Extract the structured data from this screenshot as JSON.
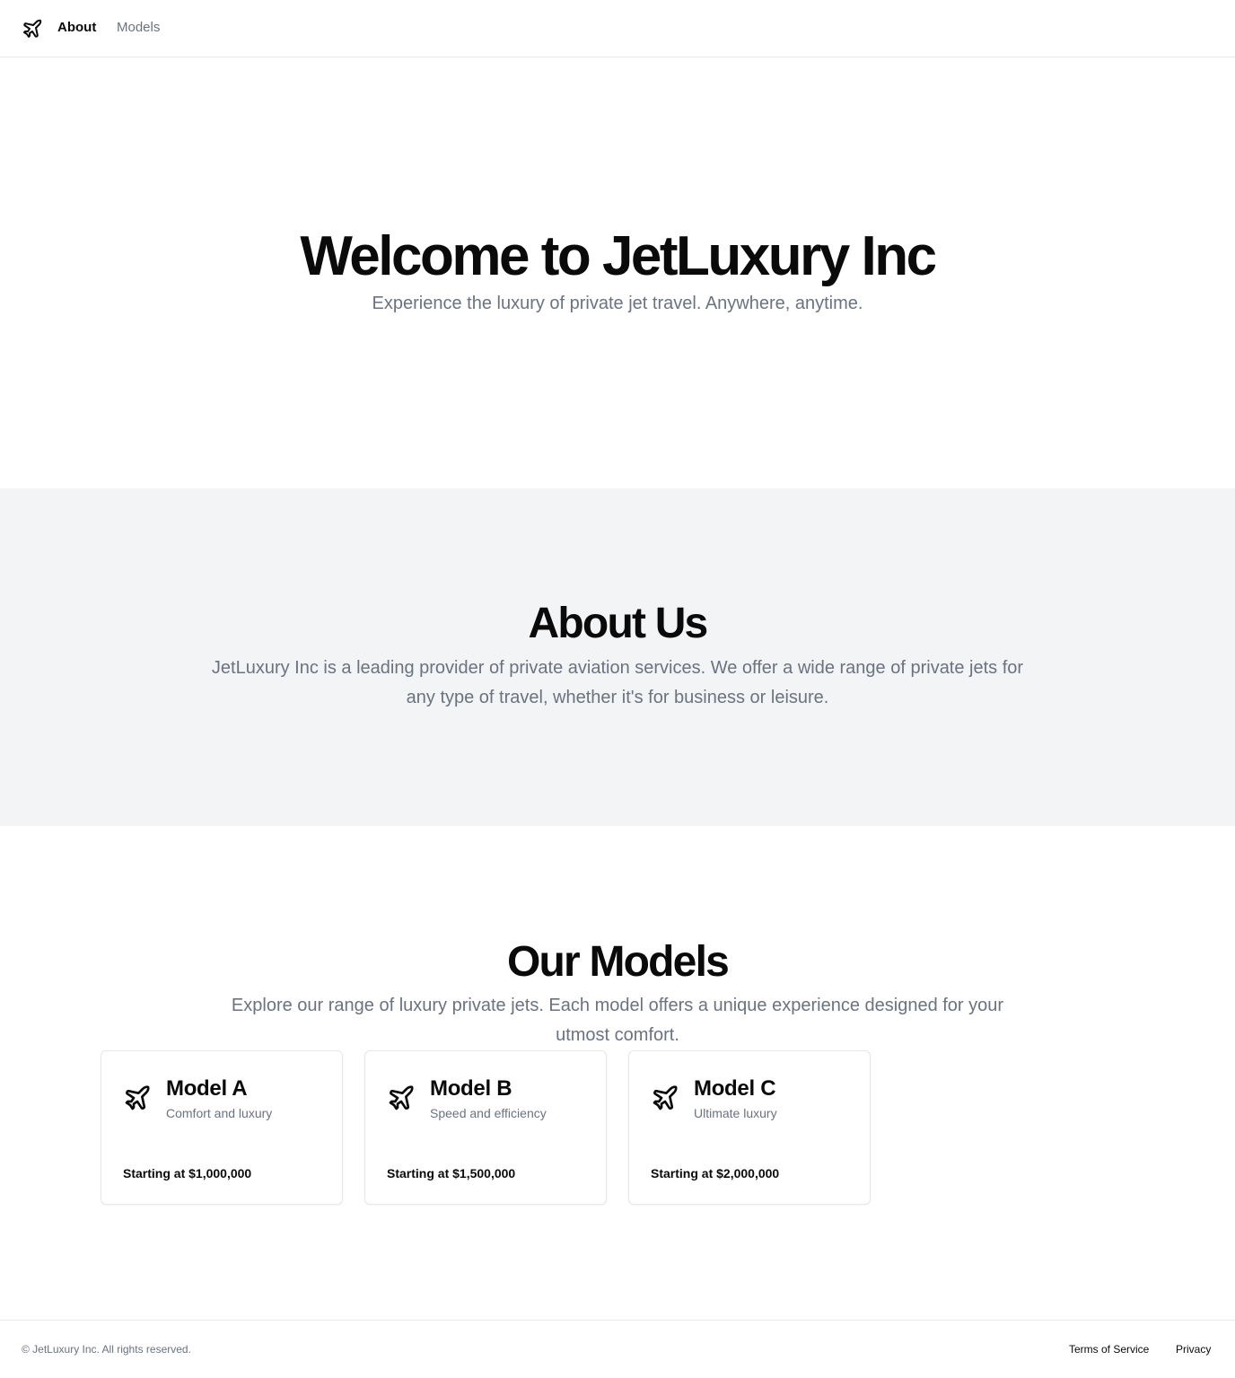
{
  "nav": {
    "logo_icon": "plane-icon",
    "items": [
      {
        "label": "About"
      },
      {
        "label": "Models"
      }
    ]
  },
  "hero": {
    "title": "Welcome to JetLuxury Inc",
    "subtitle": "Experience the luxury of private jet travel. Anywhere, anytime."
  },
  "about": {
    "title": "About Us",
    "text": "JetLuxury Inc is a leading provider of private aviation services. We offer a wide range of private jets for any type of travel, whether it's for business or leisure."
  },
  "models": {
    "title": "Our Models",
    "text": "Explore our range of luxury private jets. Each model offers a unique experience designed for your utmost comfort.",
    "cards": [
      {
        "icon": "plane-icon",
        "name": "Model A",
        "description": "Comfort and luxury",
        "price": "Starting at $1,000,000"
      },
      {
        "icon": "plane-icon",
        "name": "Model B",
        "description": "Speed and efficiency",
        "price": "Starting at $1,500,000"
      },
      {
        "icon": "plane-icon",
        "name": "Model C",
        "description": "Ultimate luxury",
        "price": "Starting at $2,000,000"
      }
    ]
  },
  "footer": {
    "copyright": "© JetLuxury Inc. All rights reserved.",
    "links": [
      {
        "label": "Terms of Service"
      },
      {
        "label": "Privacy"
      }
    ]
  },
  "colors": {
    "text": "#0a0a0a",
    "muted": "#6b7280",
    "section_bg": "#f3f4f6",
    "border": "#e5e7eb"
  }
}
